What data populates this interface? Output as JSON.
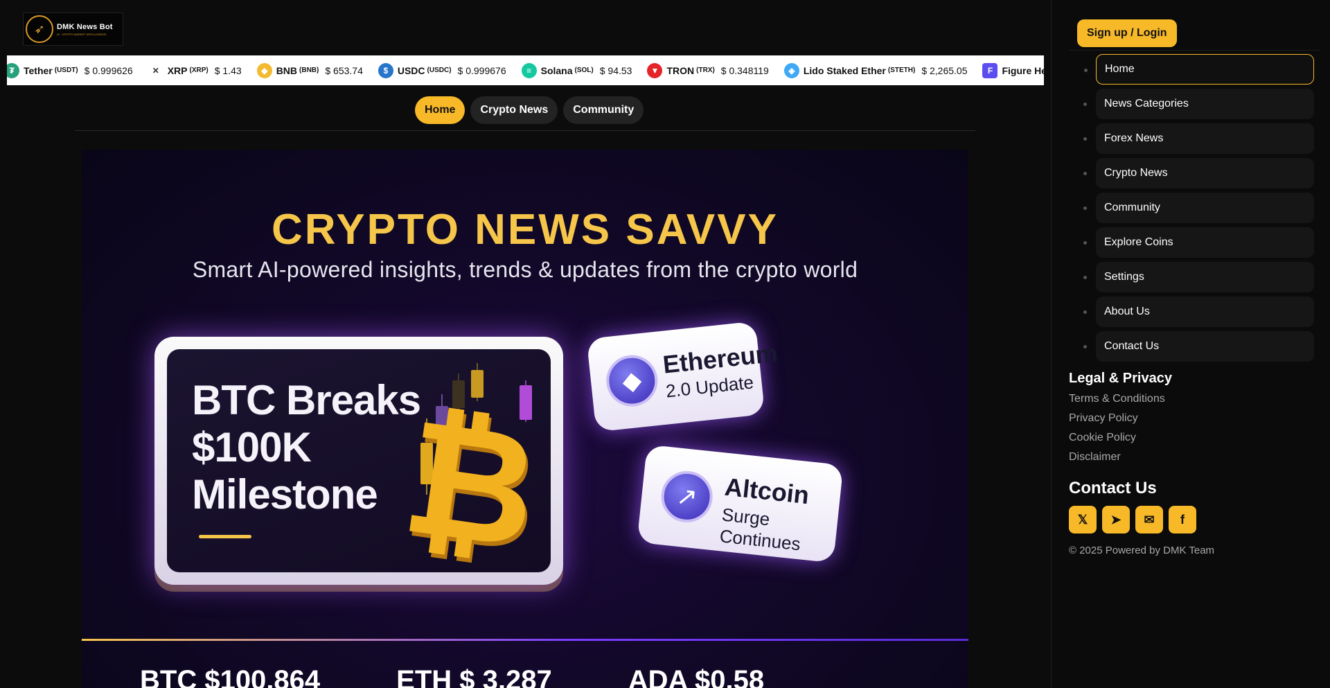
{
  "brand": {
    "name": "DMK News Bot",
    "tagline": "AI · CRYPTO MARKET INTELLIGENCE"
  },
  "ticker": [
    {
      "name": "Tether",
      "symbol": "(USDT)",
      "price": "$ 0.999626",
      "icon": "tether-icon",
      "color": "#26a17b",
      "glyph": "₮"
    },
    {
      "name": "XRP",
      "symbol": "(XRP)",
      "price": "$ 1.43",
      "icon": "xrp-icon",
      "color": "#ffffff",
      "glyph": "✕"
    },
    {
      "name": "BNB",
      "symbol": "(BNB)",
      "price": "$ 653.74",
      "icon": "bnb-icon",
      "color": "#f3ba2f",
      "glyph": "◆"
    },
    {
      "name": "USDC",
      "symbol": "(USDC)",
      "price": "$ 0.999676",
      "icon": "usdc-icon",
      "color": "#2775ca",
      "glyph": "$"
    },
    {
      "name": "Solana",
      "symbol": "(SOL)",
      "price": "$ 94.53",
      "icon": "solana-icon",
      "color": "#14c9a0",
      "glyph": "≡"
    },
    {
      "name": "TRON",
      "symbol": "(TRX)",
      "price": "$ 0.348119",
      "icon": "tron-icon",
      "color": "#e5242a",
      "glyph": "▼"
    },
    {
      "name": "Lido Staked Ether",
      "symbol": "(STETH)",
      "price": "$ 2,265.05",
      "icon": "steth-icon",
      "color": "#3fa9f5",
      "glyph": "◈"
    },
    {
      "name": "Figure Helo",
      "symbol": "",
      "price": "",
      "icon": "figure-icon",
      "color": "#5b4df0",
      "glyph": "F"
    }
  ],
  "topnav": {
    "home": "Home",
    "crypto_news": "Crypto News",
    "community": "Community"
  },
  "hero": {
    "title": "CRYPTO NEWS SAVVY",
    "subtitle": "Smart AI-powered insights, trends & updates from the crypto world",
    "main_headline": [
      "BTC Breaks",
      "$100K",
      "Milestone"
    ],
    "eth_card": {
      "title": "Ethereum",
      "subtitle": "2.0 Update"
    },
    "alt_card": {
      "title": "Altcoin",
      "subtitle": "Surge Continues"
    },
    "prices": {
      "btc": "BTC $100,864",
      "eth": "ETH $ 3,287",
      "ada": "ADA $0.58"
    }
  },
  "sidebar": {
    "signin": "Sign up / Login",
    "menu": [
      "Home",
      "News Categories",
      "Forex News",
      "Crypto News",
      "Community",
      "Explore Coins",
      "Settings",
      "About Us",
      "Contact Us"
    ],
    "legal_heading": "Legal & Privacy",
    "legal_links": [
      "Terms & Conditions",
      "Privacy Policy",
      "Cookie Policy",
      "Disclaimer"
    ],
    "contact_heading": "Contact Us",
    "socials": [
      "x-icon",
      "telegram-icon",
      "mail-icon",
      "facebook-icon"
    ],
    "copyright": "© 2025 Powered by DMK Team"
  },
  "colors": {
    "accent": "#f7b928",
    "hero_title": "#f6c64a",
    "background": "#0c0c0c"
  }
}
